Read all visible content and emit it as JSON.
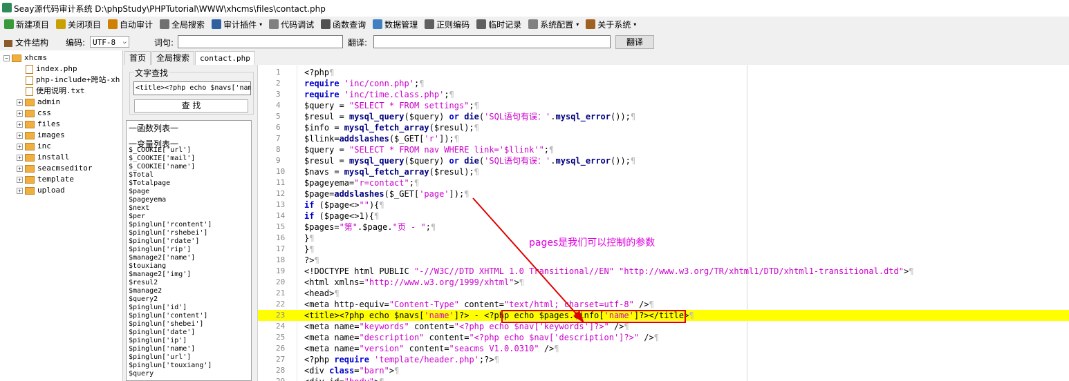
{
  "window": {
    "title": "Seay源代码审计系统  D:\\phpStudy\\PHPTutorial\\WWW\\xhcms\\files\\contact.php"
  },
  "toolbar": [
    {
      "label": "新建项目",
      "icon": "new-project-icon",
      "color": "#3a9a3a"
    },
    {
      "label": "关闭项目",
      "icon": "close-project-icon",
      "color": "#c8a000"
    },
    {
      "label": "自动审计",
      "icon": "auto-audit-icon",
      "color": "#d08000"
    },
    {
      "label": "全局搜索",
      "icon": "global-search-icon",
      "color": "#707070"
    },
    {
      "label": "审计插件",
      "icon": "plugin-icon",
      "color": "#3060a0",
      "dropdown": true
    },
    {
      "label": "代码调试",
      "icon": "debug-icon",
      "color": "#808080"
    },
    {
      "label": "函数查询",
      "icon": "function-query-icon",
      "color": "#505050"
    },
    {
      "label": "数据管理",
      "icon": "data-manage-icon",
      "color": "#4080c0"
    },
    {
      "label": "正则编码",
      "icon": "regex-icon",
      "color": "#606060"
    },
    {
      "label": "临时记录",
      "icon": "notes-icon",
      "color": "#606060"
    },
    {
      "label": "系统配置",
      "icon": "gear-icon",
      "color": "#808080",
      "dropdown": true
    },
    {
      "label": "关于系统",
      "icon": "about-icon",
      "color": "#a06020",
      "dropdown": true
    }
  ],
  "bar2": {
    "file_structure": "文件结构",
    "encoding_label": "编码:",
    "encoding_value": "UTF-8",
    "word_label": "词句:",
    "translate_label": "翻译:",
    "translate_button": "翻译"
  },
  "tree": [
    {
      "label": "xhcms",
      "type": "folder",
      "level": 0,
      "expand": "−"
    },
    {
      "label": "index.php",
      "type": "file",
      "level": 1
    },
    {
      "label": "php-include+跨站-xh",
      "type": "file",
      "level": 1
    },
    {
      "label": "使用说明.txt",
      "type": "file",
      "level": 1
    },
    {
      "label": "admin",
      "type": "folder",
      "level": 1,
      "expand": "+"
    },
    {
      "label": "css",
      "type": "folder",
      "level": 1,
      "expand": "+"
    },
    {
      "label": "files",
      "type": "folder",
      "level": 1,
      "expand": "+"
    },
    {
      "label": "images",
      "type": "folder",
      "level": 1,
      "expand": "+"
    },
    {
      "label": "inc",
      "type": "folder",
      "level": 1,
      "expand": "+"
    },
    {
      "label": "install",
      "type": "folder",
      "level": 1,
      "expand": "+"
    },
    {
      "label": "seacmseditor",
      "type": "folder",
      "level": 1,
      "expand": "+"
    },
    {
      "label": "template",
      "type": "folder",
      "level": 1,
      "expand": "+"
    },
    {
      "label": "upload",
      "type": "folder",
      "level": 1,
      "expand": "+"
    }
  ],
  "tabs": [
    "首页",
    "全局搜索",
    "contact.php"
  ],
  "search": {
    "group_label": "文字查找",
    "input_value": "<title><?php echo $navs['nam",
    "button": "查 找"
  },
  "func_panel": {
    "func_header": "一函数列表一",
    "var_header": "一变量列表一",
    "vars": [
      "$_COOKIE['url']",
      "$_COOKIE['mail']",
      "$_COOKIE['name']",
      "$Total",
      "$Totalpage",
      "$page",
      "$pageyema",
      "$next",
      "$per",
      "$pinglun['rcontent']",
      "$pinglun['rshebei']",
      "$pinglun['rdate']",
      "$pinglun['rip']",
      "$manage2['name']",
      "$touxiang",
      "$manage2['img']",
      "$resul2",
      "$manage2",
      "$query2",
      "$pinglun['id']",
      "$pinglun['content']",
      "$pinglun['shebei']",
      "$pinglun['date']",
      "$pinglun['ip']",
      "$pinglun['name']",
      "$pinglun['url']",
      "$pinglun['touxiang']",
      "$query"
    ]
  },
  "code": [
    [
      [
        "t",
        "<?php"
      ]
    ],
    [
      [
        "k",
        "require"
      ],
      [
        "t",
        " "
      ],
      [
        "s",
        "'inc/conn.php'"
      ],
      [
        "t",
        ";"
      ]
    ],
    [
      [
        "k",
        "require"
      ],
      [
        "t",
        " "
      ],
      [
        "s",
        "'inc/time.class.php'"
      ],
      [
        "t",
        ";"
      ]
    ],
    [
      [
        "t",
        "$query = "
      ],
      [
        "s",
        "\"SELECT * FROM settings\""
      ],
      [
        "t",
        ";"
      ]
    ],
    [
      [
        "t",
        "$resul = "
      ],
      [
        "f",
        "mysql_query"
      ],
      [
        "t",
        "($query) "
      ],
      [
        "k",
        "or"
      ],
      [
        "t",
        " "
      ],
      [
        "f",
        "die"
      ],
      [
        "t",
        "("
      ],
      [
        "s",
        "'SQL语句有误：'"
      ],
      [
        "t",
        "."
      ],
      [
        "f",
        "mysql_error"
      ],
      [
        "t",
        "());"
      ]
    ],
    [
      [
        "t",
        "$info = "
      ],
      [
        "f",
        "mysql_fetch_array"
      ],
      [
        "t",
        "($resul);"
      ]
    ],
    [
      [
        "t",
        "$llink="
      ],
      [
        "f",
        "addslashes"
      ],
      [
        "t",
        "($_GET["
      ],
      [
        "s",
        "'r'"
      ],
      [
        "t",
        "]);"
      ]
    ],
    [
      [
        "t",
        "$query = "
      ],
      [
        "s",
        "\"SELECT * FROM nav WHERE link='$llink'\""
      ],
      [
        "t",
        ";"
      ]
    ],
    [
      [
        "t",
        "$resul = "
      ],
      [
        "f",
        "mysql_query"
      ],
      [
        "t",
        "($query) "
      ],
      [
        "k",
        "or"
      ],
      [
        "t",
        " "
      ],
      [
        "f",
        "die"
      ],
      [
        "t",
        "("
      ],
      [
        "s",
        "'SQL语句有误：'"
      ],
      [
        "t",
        "."
      ],
      [
        "f",
        "mysql_error"
      ],
      [
        "t",
        "());"
      ]
    ],
    [
      [
        "t",
        "$navs = "
      ],
      [
        "f",
        "mysql_fetch_array"
      ],
      [
        "t",
        "($resul);"
      ]
    ],
    [
      [
        "t",
        "$pageyema="
      ],
      [
        "s",
        "\"r=contact\""
      ],
      [
        "t",
        ";"
      ]
    ],
    [
      [
        "t",
        "$page="
      ],
      [
        "f",
        "addslashes"
      ],
      [
        "t",
        "($_GET["
      ],
      [
        "s",
        "'page'"
      ],
      [
        "t",
        "]);"
      ]
    ],
    [
      [
        "k",
        "if"
      ],
      [
        "t",
        " ($page<>"
      ],
      [
        "s",
        "\"\""
      ],
      [
        "t",
        "){"
      ]
    ],
    [
      [
        "k",
        "if"
      ],
      [
        "t",
        " ($page<>1){"
      ]
    ],
    [
      [
        "t",
        "$pages="
      ],
      [
        "s",
        "\"第\""
      ],
      [
        "t",
        ".$page."
      ],
      [
        "s",
        "\"页 - \""
      ],
      [
        "t",
        ";"
      ]
    ],
    [
      [
        "t",
        "}"
      ]
    ],
    [
      [
        "t",
        "}"
      ]
    ],
    [
      [
        "t",
        "?>"
      ]
    ],
    [
      [
        "t",
        "<!DOCTYPE html PUBLIC "
      ],
      [
        "s",
        "\"-//W3C//DTD XHTML 1.0 Transitional//EN\""
      ],
      [
        "t",
        " "
      ],
      [
        "s",
        "\"http://www.w3.org/TR/xhtml1/DTD/xhtml1-transitional.dtd\""
      ],
      [
        "t",
        ">"
      ]
    ],
    [
      [
        "t",
        "<html xmlns="
      ],
      [
        "s",
        "\"http://www.w3.org/1999/xhtml\""
      ],
      [
        "t",
        ">"
      ]
    ],
    [
      [
        "t",
        "<head>"
      ]
    ],
    [
      [
        "t",
        "<meta http-equiv="
      ],
      [
        "s",
        "\"Content-Type\""
      ],
      [
        "t",
        " content="
      ],
      [
        "s",
        "\"text/html; charset=utf-8\""
      ],
      [
        "t",
        " />"
      ]
    ],
    [
      [
        "t",
        "<title><?php echo $navs["
      ],
      [
        "s",
        "'name'"
      ],
      [
        "t",
        "]?> - <?php echo $pages.$info["
      ],
      [
        "s",
        "'name'"
      ],
      [
        "t",
        "]?></title>"
      ]
    ],
    [
      [
        "t",
        "<meta name="
      ],
      [
        "s",
        "\"keywords\""
      ],
      [
        "t",
        " content="
      ],
      [
        "s",
        "\"<?php echo $nav['keywords']?>\""
      ],
      [
        "t",
        " />"
      ]
    ],
    [
      [
        "t",
        "<meta name="
      ],
      [
        "s",
        "\"description\""
      ],
      [
        "t",
        " content="
      ],
      [
        "s",
        "\"<?php echo $nav['description']?>\""
      ],
      [
        "t",
        " />"
      ]
    ],
    [
      [
        "t",
        "<meta name="
      ],
      [
        "s",
        "\"version\""
      ],
      [
        "t",
        " content="
      ],
      [
        "s",
        "\"seacms V1.0.0310\""
      ],
      [
        "t",
        " />"
      ]
    ],
    [
      [
        "t",
        "<?php "
      ],
      [
        "k",
        "require"
      ],
      [
        "t",
        " "
      ],
      [
        "s",
        "'template/header.php'"
      ],
      [
        "t",
        ";?>"
      ]
    ],
    [
      [
        "t",
        "<div "
      ],
      [
        "k",
        "class"
      ],
      [
        "t",
        "="
      ],
      [
        "s",
        "\"barn\""
      ],
      [
        "t",
        ">"
      ]
    ],
    [
      [
        "t",
        "<div id="
      ],
      [
        "s",
        "\"body\""
      ],
      [
        "t",
        ">"
      ]
    ]
  ],
  "highlight_line": 23,
  "annotation": "pages是我们可以控制的参数"
}
